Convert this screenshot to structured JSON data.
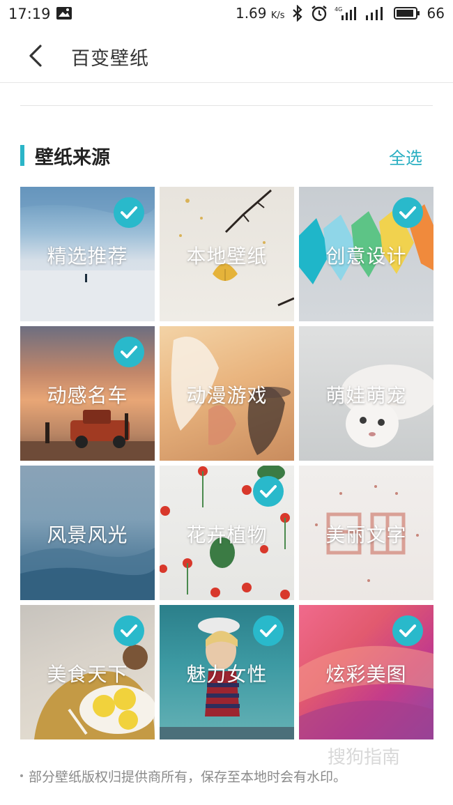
{
  "status_bar": {
    "time": "17:19",
    "speed_value": "1.69",
    "speed_unit": "K/s",
    "battery": "66"
  },
  "header": {
    "title": "百变壁纸"
  },
  "section": {
    "title": "壁纸来源",
    "select_all": "全选"
  },
  "tiles": [
    {
      "label": "精选推荐",
      "checked": true
    },
    {
      "label": "本地壁纸",
      "checked": false
    },
    {
      "label": "创意设计",
      "checked": true
    },
    {
      "label": "动感名车",
      "checked": true
    },
    {
      "label": "动漫游戏",
      "checked": false
    },
    {
      "label": "萌娃萌宠",
      "checked": false
    },
    {
      "label": "风景风光",
      "checked": false
    },
    {
      "label": "花卉植物",
      "checked": true
    },
    {
      "label": "美丽文字",
      "checked": false
    },
    {
      "label": "美食天下",
      "checked": true
    },
    {
      "label": "魅力女性",
      "checked": true
    },
    {
      "label": "炫彩美图",
      "checked": true
    }
  ],
  "footer": {
    "note": "部分壁纸版权归提供商所有，保存至本地时会有水印。"
  },
  "watermark": "搜狗指南",
  "colors": {
    "accent": "#29b9cb",
    "select_all": "#29afc2"
  },
  "icons": {
    "back": "chevron-left-icon",
    "check": "check-circle-icon"
  }
}
